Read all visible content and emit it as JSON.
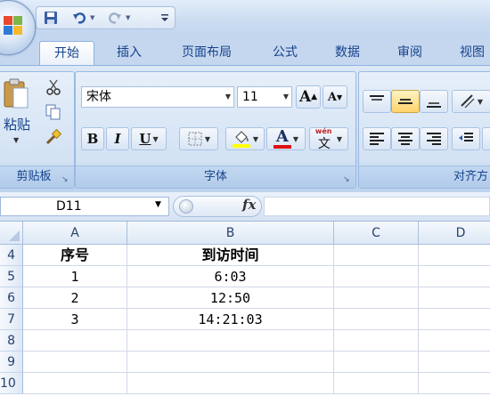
{
  "quick_access": {
    "save_icon": "save-icon",
    "undo_icon": "undo-icon",
    "redo_icon": "redo-icon",
    "customize_icon": "customize-qat-icon"
  },
  "tabs": [
    {
      "label": "开始",
      "active": true
    },
    {
      "label": "插入"
    },
    {
      "label": "页面布局"
    },
    {
      "label": "公式"
    },
    {
      "label": "数据"
    },
    {
      "label": "审阅"
    },
    {
      "label": "视图"
    }
  ],
  "ribbon": {
    "clipboard": {
      "paste_label": "粘贴",
      "group_label": "剪贴板"
    },
    "font": {
      "font_name": "宋体",
      "font_size": "11",
      "grow_label": "A",
      "shrink_label": "A",
      "bold_label": "B",
      "italic_label": "I",
      "underline_label": "U",
      "font_color_label": "A",
      "phonetic_top": "wén",
      "phonetic_char": "文",
      "group_label": "字体"
    },
    "alignment": {
      "group_label": "对齐方"
    }
  },
  "formula_bar": {
    "name_box": "D11",
    "fx_label": "fx",
    "formula": ""
  },
  "sheet": {
    "columns": [
      "A",
      "B",
      "C",
      "D"
    ],
    "rows": [
      {
        "num": "4",
        "cells": [
          "序号",
          "到访时间",
          "",
          ""
        ]
      },
      {
        "num": "5",
        "cells": [
          "1",
          "6:03",
          "",
          ""
        ]
      },
      {
        "num": "6",
        "cells": [
          "2",
          "12:50",
          "",
          ""
        ]
      },
      {
        "num": "7",
        "cells": [
          "3",
          "14:21:03",
          "",
          ""
        ]
      },
      {
        "num": "8",
        "cells": [
          "",
          "",
          "",
          ""
        ]
      },
      {
        "num": "9",
        "cells": [
          "",
          "",
          "",
          ""
        ]
      },
      {
        "num": "10",
        "cells": [
          "",
          "",
          "",
          ""
        ]
      }
    ]
  },
  "colors": {
    "ribbon_blue": "#c7d9f1",
    "tab_text": "#15428b",
    "highlight_yellow": "#ffd46a",
    "font_color_red": "#e01010",
    "fill_color_yellow": "#ffff00"
  }
}
